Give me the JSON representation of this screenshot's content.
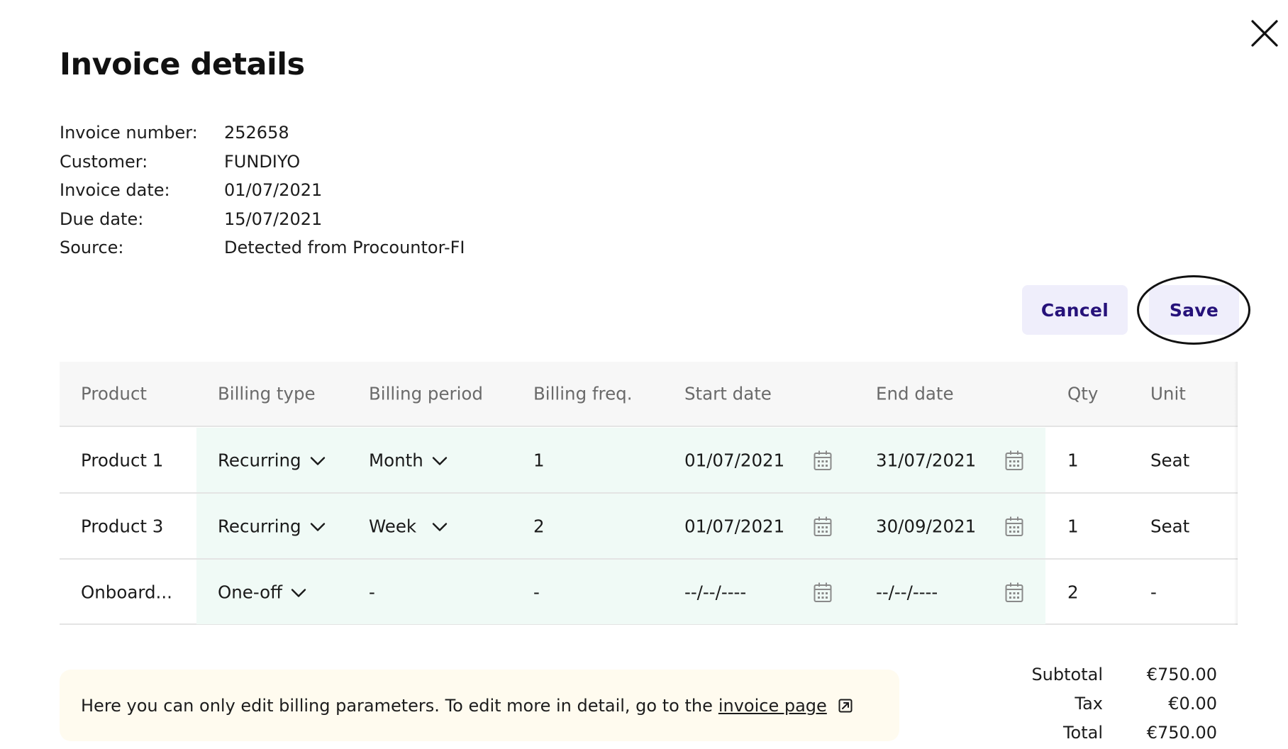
{
  "dialog": {
    "title": "Invoice details",
    "close_icon": "close-icon"
  },
  "meta": {
    "rows": [
      {
        "label": "Invoice number:",
        "value": "252658"
      },
      {
        "label": "Customer:",
        "value": "FUNDIYO"
      },
      {
        "label": "Invoice date:",
        "value": "01/07/2021"
      },
      {
        "label": "Due date:",
        "value": "15/07/2021"
      },
      {
        "label": "Source:",
        "value": "Detected from Procountor-FI"
      }
    ]
  },
  "actions": {
    "cancel_label": "Cancel",
    "save_label": "Save"
  },
  "table": {
    "headers": [
      "Product",
      "Billing type",
      "Billing period",
      "Billing freq.",
      "Start date",
      "End date",
      "Qty",
      "Unit"
    ],
    "rows": [
      {
        "product": "Product 1",
        "billing_type": "Recurring",
        "billing_period": "Month",
        "billing_freq": "1",
        "start_date": "01/07/2021",
        "end_date": "31/07/2021",
        "qty": "1",
        "unit": "Seat"
      },
      {
        "product": "Product 3",
        "billing_type": "Recurring",
        "billing_period": "Week",
        "billing_freq": "2",
        "start_date": "01/07/2021",
        "end_date": "30/09/2021",
        "qty": "1",
        "unit": "Seat"
      },
      {
        "product": "Onboard...",
        "billing_type": "One-off",
        "billing_period": "-",
        "billing_freq": "-",
        "start_date": "--/--/----",
        "end_date": "--/--/----",
        "qty": "2",
        "unit": "-"
      }
    ],
    "icons": {
      "dropdown": "chevron-down-icon",
      "date": "calendar-icon"
    }
  },
  "notice": {
    "text": "Here you can only edit billing parameters. To edit more in detail, go to the",
    "link_text": "invoice page",
    "link_icon": "external-link-icon"
  },
  "totals": {
    "rows": [
      {
        "label": "Subtotal",
        "value": "€750.00"
      },
      {
        "label": "Tax",
        "value": "€0.00"
      },
      {
        "label": "Total",
        "value": "€750.00"
      }
    ]
  },
  "colors": {
    "accent_text": "#26127a",
    "button_bg": "#efeefb",
    "editable_cell_bg": "#f0faf6",
    "notice_bg": "#fffbef"
  }
}
